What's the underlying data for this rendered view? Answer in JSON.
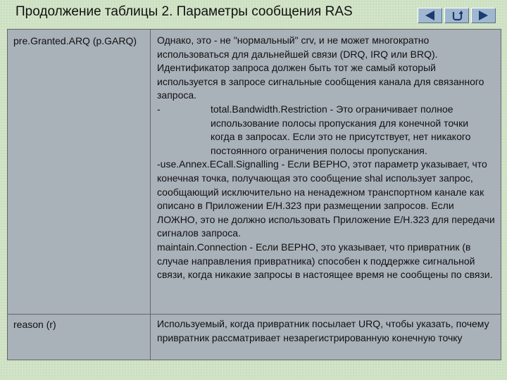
{
  "slide": {
    "title": "Продолжение таблицы 2. Параметры сообщения RAS"
  },
  "nav": {
    "prev": "triangle-left-icon",
    "return": "return-arrow-icon",
    "next": "triangle-right-icon"
  },
  "table": {
    "rows": [
      {
        "name": "pre.Granted.ARQ (p.GARQ)",
        "paragraphs": [
          "Однако, это - не \"нормальный\" crv, и не может многократно использоваться для дальнейшей связи (DRQ, IRQ или BRQ). Идентификатор запроса должен быть тот же самый который используется в запросе сигнальные сообщения канала для связанного запроса.",
          "total.Bandwidth.Restriction - Это ограничивает полное использование полосы пропускания для конечной точки когда в запросах. Если это не присутствует, нет никакого постоянного ограничения полосы пропускания.",
          "-use.Annex.ECall.Signalling - Если ВЕРНО, этот параметр указывает, что конечная точка, получающая это сообщение shal использует запрос, сообщающий исключительно на ненадежном транспортном канале как описано в Приложении E/H.323 при размещении запросов. Если ЛОЖНО, это не должно использовать Приложение E/H.323 для передачи сигналов запроса.",
          "maintain.Connection - Если ВЕРНО, это указывает, что привратник (в случае направления привратника) способен к поддержке сигнальной связи, когда никакие запросы в настоящее время не сообщены по связи."
        ],
        "sub_dash": "-"
      },
      {
        "name": "reason (r)",
        "paragraphs": [
          "Используемый, когда привратник посылает URQ, чтобы указать, почему привратник рассматривает незарегистрированную конечную точку"
        ]
      }
    ]
  }
}
